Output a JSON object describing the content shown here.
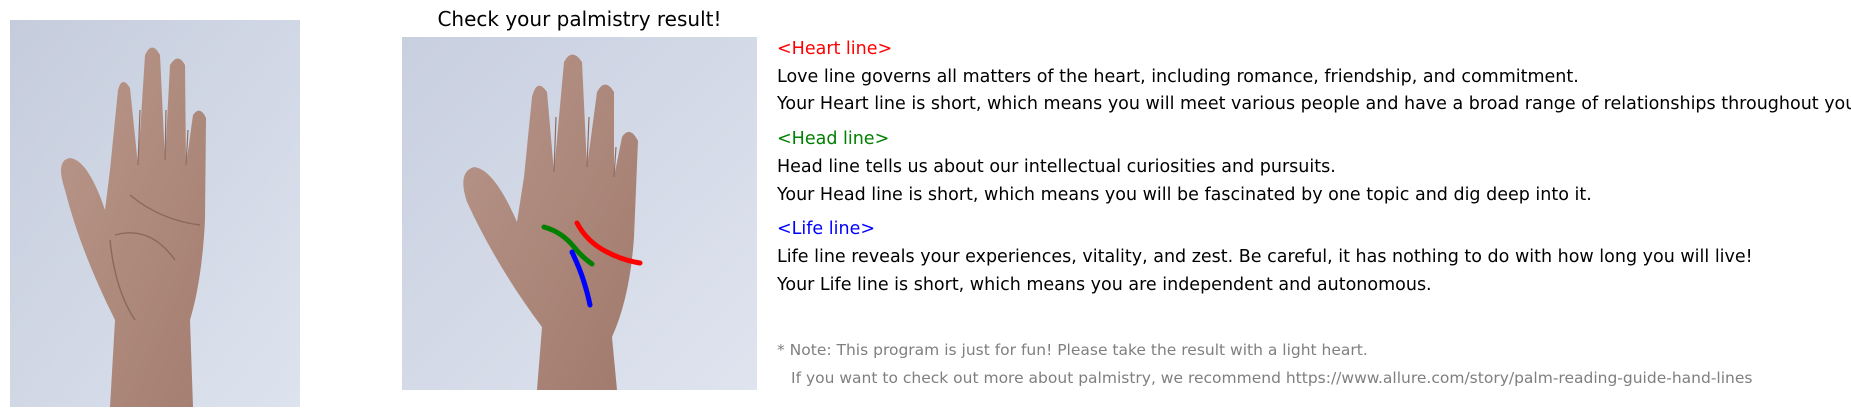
{
  "title": "Check your palmistry result!",
  "colors": {
    "heart": "#ff0000",
    "head": "#008000",
    "life": "#0000ff",
    "note": "#7f7f7f"
  },
  "results": {
    "heart": {
      "heading": "<Heart line>",
      "description": "Love line governs all matters of the heart, including romance, friendship, and commitment.",
      "result": "Your Heart line is short, which means you will meet various people and have a broad range of relationships throughout your life."
    },
    "head": {
      "heading": "<Head line>",
      "description": "Head line tells us about our intellectual curiosities and pursuits.",
      "result": "Your Head line is short, which means you will be fascinated by one topic and dig deep into it."
    },
    "life": {
      "heading": "<Life line>",
      "description": "Life line reveals your experiences, vitality, and zest. Be careful, it has nothing to do with how long you will live!",
      "result": "Your Life line is short, which means you are independent and autonomous."
    }
  },
  "note": {
    "line1": "* Note: This program is just for fun! Please take the result with a light heart.",
    "line2": "If you want to check out more about palmistry, we recommend https://www.allure.com/story/palm-reading-guide-hand-lines"
  }
}
